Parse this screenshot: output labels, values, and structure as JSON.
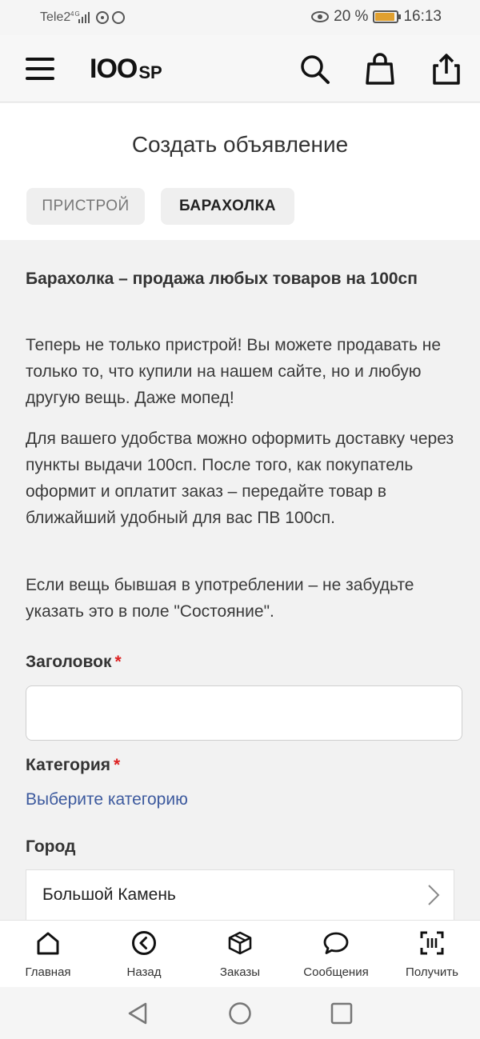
{
  "status_bar": {
    "carrier": "Tele2",
    "network": "4G",
    "battery_percent": "20 %",
    "time": "16:13"
  },
  "header": {
    "logo_number": "IOO",
    "logo_suffix": "SP",
    "icons": [
      "menu-icon",
      "search-icon",
      "bag-icon",
      "share-icon"
    ]
  },
  "page": {
    "title": "Создать объявление",
    "tabs": [
      {
        "label": "ПРИСТРОЙ",
        "active": false
      },
      {
        "label": "БАРАХОЛКА",
        "active": true
      }
    ]
  },
  "content": {
    "heading": "Барахолка – продажа любых товаров на 100сп",
    "paragraphs": [
      "Теперь не только пристрой! Вы можете продавать не только то, что купили на нашем сайте, но и любую другую вещь. Даже мопед!",
      "Для вашего удобства можно оформить доставку через пункты выдачи 100сп. После того, как покупатель оформит и оплатит заказ – передайте товар в ближайший удобный для вас ПВ 100сп.",
      "Если вещь бывшая в употреблении – не забудьте указать это в поле \"Состояние\"."
    ]
  },
  "form": {
    "title_label": "Заголовок",
    "required_mark": "*",
    "title_value": "",
    "category_label": "Категория",
    "category_link": "Выберите категорию",
    "city_label": "Город",
    "city_value": "Большой Камень"
  },
  "bottom_nav": {
    "items": [
      {
        "label": "Главная",
        "icon": "home-icon"
      },
      {
        "label": "Назад",
        "icon": "back-icon"
      },
      {
        "label": "Заказы",
        "icon": "box-icon"
      },
      {
        "label": "Сообщения",
        "icon": "chat-icon"
      },
      {
        "label": "Получить",
        "icon": "barcode-icon"
      }
    ]
  },
  "colors": {
    "accent_link": "#3d5a9e",
    "required": "#dd2222",
    "background": "#f2f2f2"
  }
}
